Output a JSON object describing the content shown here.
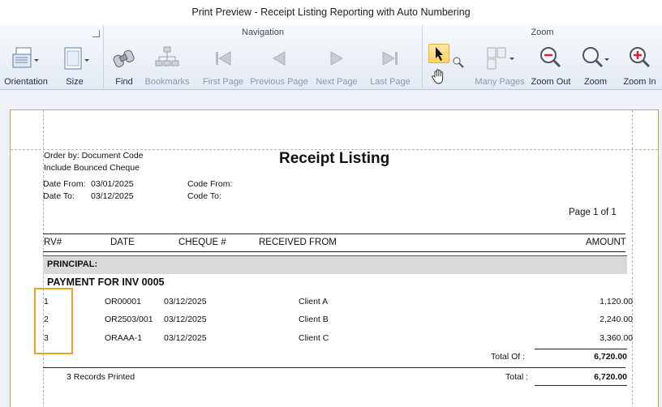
{
  "window": {
    "title": "Print Preview - Receipt Listing Reporting with Auto Numbering"
  },
  "ribbon": {
    "page_setup": {
      "orientation_label": "Orientation",
      "size_label": "Size"
    },
    "navigation": {
      "title": "Navigation",
      "find_label": "Find",
      "bookmarks_label": "Bookmarks",
      "first_page_label": "First Page",
      "previous_page_label": "Previous Page",
      "next_page_label": "Next  Page",
      "last_page_label": "Last  Page"
    },
    "zoom": {
      "title": "Zoom",
      "many_pages_label": "Many Pages",
      "zoom_out_label": "Zoom Out",
      "zoom_label": "Zoom",
      "zoom_in_label": "Zoom In"
    }
  },
  "report": {
    "order_by": "Order by: Document Code",
    "include_bounced": "Include Bounced Cheque",
    "title": "Receipt Listing",
    "date_from_label": "Date From:",
    "date_from_value": "03/01/2025",
    "date_to_label": "Date To:",
    "date_to_value": "03/12/2025",
    "code_from_label": "Code From:",
    "code_to_label": "Code To:",
    "page_info": "Page 1 of 1",
    "columns": {
      "rv": "RV#",
      "date": "DATE",
      "cheque": "CHEQUE #",
      "received_from": "RECEIVED FROM",
      "amount": "AMOUNT"
    },
    "section": "PRINCIPAL:",
    "group": "PAYMENT FOR INV 0005",
    "rows": [
      {
        "rv": "1",
        "doc": "OR00001",
        "date": "03/12/2025",
        "client": "Client A",
        "amount": "1,120.00"
      },
      {
        "rv": "2",
        "doc": "OR2503/001",
        "date": "03/12/2025",
        "client": "Client B",
        "amount": "2,240.00"
      },
      {
        "rv": "3",
        "doc": "ORAAA-1",
        "date": "03/12/2025",
        "client": "Client C",
        "amount": "3,360.00"
      }
    ],
    "total_of_label": "Total Of  :",
    "total_of_value": "6,720.00",
    "records_printed": "3 Records Printed",
    "total_label": "Total :",
    "total_value": "6,720.00"
  }
}
